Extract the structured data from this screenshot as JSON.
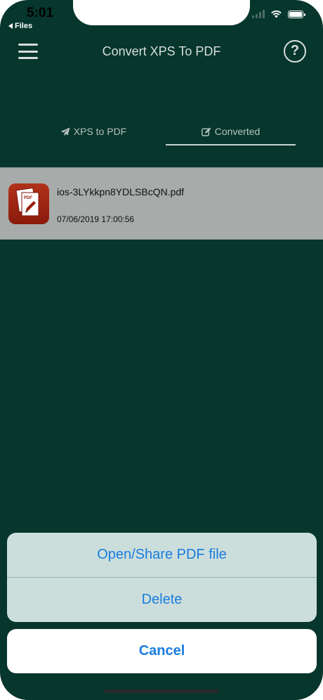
{
  "status_bar": {
    "time": "5:01",
    "back_label": "Files",
    "icons": [
      "signal-icon",
      "wifi-icon",
      "battery-icon"
    ]
  },
  "nav": {
    "title": "Convert XPS To PDF",
    "menu_icon": "hamburger-menu-icon",
    "help_icon": "question-mark-icon",
    "help_glyph": "?"
  },
  "tabs": [
    {
      "label": "XPS to PDF",
      "icon": "paper-plane-icon",
      "selected": false
    },
    {
      "label": "Converted",
      "icon": "edit-icon",
      "selected": true
    }
  ],
  "files": [
    {
      "name": "ios-3LYkkpn8YDLSBcQN.pdf",
      "date": "07/06/2019 17:00:56",
      "icon": "pdf-file-icon"
    }
  ],
  "action_sheet": {
    "open_share_label": "Open/Share PDF file",
    "delete_label": "Delete",
    "cancel_label": "Cancel"
  },
  "colors": {
    "background": "#06362c",
    "action_text": "#1a7de0",
    "sheet_background": "#ccdedb",
    "row_background": "#a7aba9"
  }
}
